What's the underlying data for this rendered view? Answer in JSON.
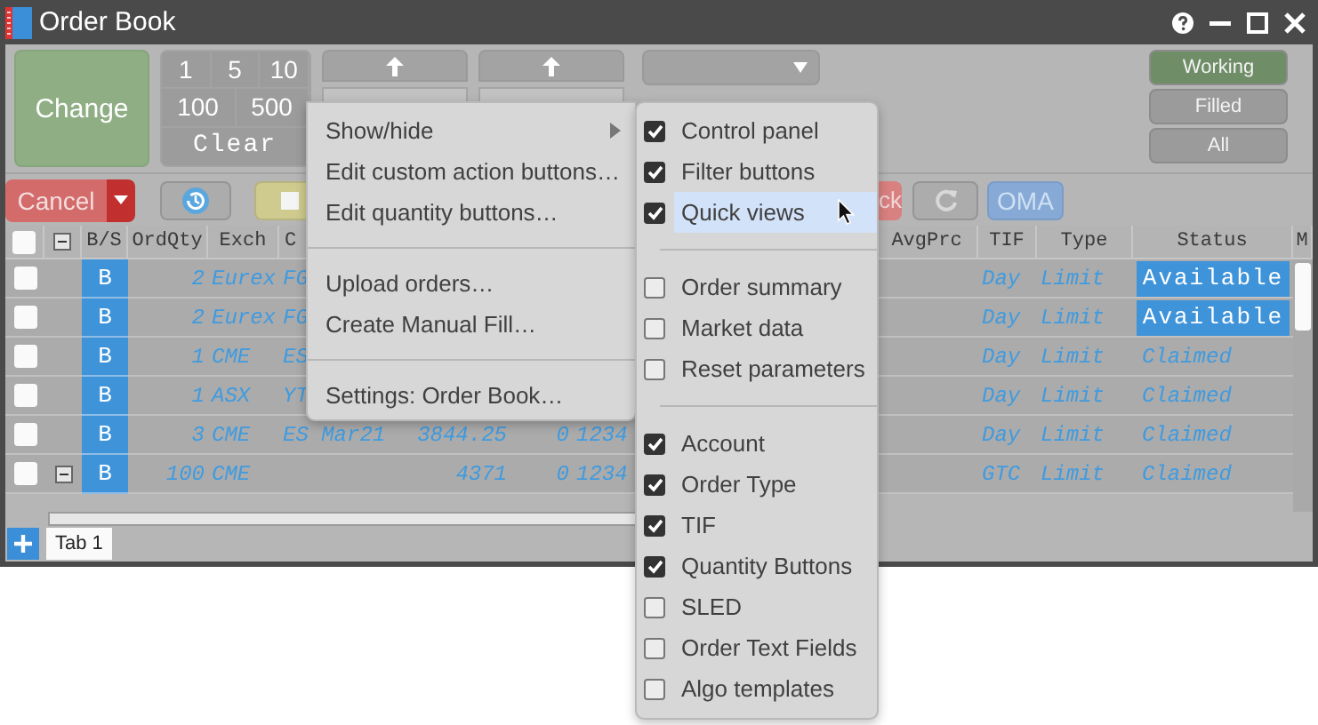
{
  "window": {
    "title": "Order Book"
  },
  "control_panel": {
    "change_button": "Change",
    "quantity_buttons": [
      "1",
      "5",
      "10",
      "100",
      "500"
    ],
    "clear_button": "Clear",
    "filters": [
      {
        "label": "Working",
        "selected": true
      },
      {
        "label": "Filled",
        "selected": false
      },
      {
        "label": "All",
        "selected": false
      }
    ]
  },
  "toolbar": {
    "cancel_button": "Cancel",
    "partial_button": "ck",
    "oma_button": "OMA"
  },
  "table": {
    "select_all_checked": false,
    "columns": [
      "B/S",
      "OrdQty",
      "Exch",
      "C",
      "AvgPrc",
      "TIF",
      "Type",
      "Status",
      "M"
    ],
    "rows": [
      {
        "checked": false,
        "expanded": false,
        "side": "B",
        "qty": "2",
        "exch": "Eurex",
        "contract": "FG",
        "tif": "Day",
        "type": "Limit",
        "status": {
          "text": "Available",
          "kind": "badge"
        }
      },
      {
        "checked": false,
        "expanded": false,
        "side": "B",
        "qty": "2",
        "exch": "Eurex",
        "contract": "FG",
        "tif": "Day",
        "type": "Limit",
        "status": {
          "text": "Available",
          "kind": "badge"
        }
      },
      {
        "checked": false,
        "expanded": false,
        "side": "B",
        "qty": "1",
        "exch": "CME",
        "contract": "ES",
        "tif": "Day",
        "type": "Limit",
        "status": {
          "text": "Claimed",
          "kind": "text"
        }
      },
      {
        "checked": false,
        "expanded": false,
        "side": "B",
        "qty": "1",
        "exch": "ASX",
        "contract": "YT",
        "tif": "Day",
        "type": "Limit",
        "status": {
          "text": "Claimed",
          "kind": "text"
        }
      },
      {
        "checked": false,
        "expanded": false,
        "side": "B",
        "qty": "3",
        "exch": "CME",
        "contract": "ES Mar21",
        "price": "3844.25",
        "filled": "0",
        "account": "1234",
        "tif": "Day",
        "type": "Limit",
        "status": {
          "text": "Claimed",
          "kind": "text"
        }
      },
      {
        "checked": false,
        "expanded": true,
        "side": "B",
        "qty": "100",
        "exch": "CME",
        "price": "4371",
        "filled": "0",
        "account": "1234",
        "tif": "GTC",
        "type": "Limit",
        "status": {
          "text": "Claimed",
          "kind": "text"
        }
      }
    ]
  },
  "tabs": [
    {
      "label": "Tab 1",
      "selected": true
    }
  ],
  "context_menu": {
    "groups": [
      [
        {
          "label": "Show/hide",
          "submenu": true
        },
        {
          "label": "Edit custom action buttons…",
          "submenu": false
        },
        {
          "label": "Edit quantity buttons…",
          "submenu": false
        }
      ],
      [
        {
          "label": "Upload orders…",
          "submenu": false
        },
        {
          "label": "Create Manual Fill…",
          "submenu": false
        }
      ],
      [
        {
          "label": "Settings: Order Book…",
          "submenu": false
        }
      ]
    ]
  },
  "submenu": {
    "groups": [
      [
        {
          "label": "Control panel",
          "checked": true,
          "selected": false
        },
        {
          "label": "Filter buttons",
          "checked": true,
          "selected": false
        },
        {
          "label": "Quick views",
          "checked": true,
          "selected": true
        }
      ],
      [
        {
          "label": "Order summary",
          "checked": false,
          "selected": false
        },
        {
          "label": "Market data",
          "checked": false,
          "selected": false
        },
        {
          "label": "Reset parameters",
          "checked": false,
          "selected": false
        }
      ],
      [
        {
          "label": "Account",
          "checked": true,
          "selected": false
        },
        {
          "label": "Order Type",
          "checked": true,
          "selected": false
        },
        {
          "label": "TIF",
          "checked": true,
          "selected": false
        },
        {
          "label": "Quantity Buttons",
          "checked": true,
          "selected": false
        },
        {
          "label": "SLED",
          "checked": false,
          "selected": false
        },
        {
          "label": "Order Text Fields",
          "checked": false,
          "selected": false
        },
        {
          "label": "Algo templates",
          "checked": false,
          "selected": false
        }
      ]
    ]
  }
}
